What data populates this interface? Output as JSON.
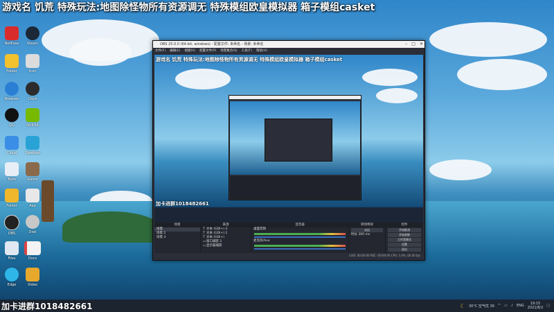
{
  "overlay": {
    "title": "游戏名 饥荒  特殊玩法:地图除怪物所有资源调无 特殊模组欧皇模拟器 箱子模组casket",
    "caption": "加卡进群1018482661"
  },
  "desktop_icons": [
    {
      "label": "NetEase"
    },
    {
      "label": "Steam"
    },
    {
      "label": "Folder"
    },
    {
      "label": "Icon"
    },
    {
      "label": "Browser"
    },
    {
      "label": "Clock"
    },
    {
      "label": "QQ"
    },
    {
      "label": "NVIDIA"
    },
    {
      "label": "Cloud"
    },
    {
      "label": "Desktop"
    },
    {
      "label": "Tools"
    },
    {
      "label": "Game"
    },
    {
      "label": "Folder"
    },
    {
      "label": "App"
    },
    {
      "label": "OBS"
    },
    {
      "label": "Disk"
    },
    {
      "label": "Files"
    },
    {
      "label": "Docs"
    },
    {
      "label": "Edge"
    },
    {
      "label": "Video"
    }
  ],
  "obs": {
    "window_title": "OBS 25.0.0 (64-bit, windows) - 配置文件: 未命名 - 场景: 未命名",
    "menu": [
      "文件(F)",
      "编辑(E)",
      "视图(V)",
      "配置文件(P)",
      "场景集合(S)",
      "工具(T)",
      "帮助(H)"
    ],
    "panels": {
      "scenes": {
        "header": "场景",
        "items": [
          "场景",
          "场景 2",
          "场景 3"
        ]
      },
      "sources": {
        "header": "来源",
        "items": [
          "文本 (GDI+) 3",
          "文本 (GDI+) 2",
          "文本 (GDI+)",
          "窗口捕获 2",
          "显示器捕获"
        ]
      },
      "mixer": {
        "header": "混音器",
        "items": [
          "桌面音频",
          "麦克风/Aux"
        ]
      },
      "transitions": {
        "header": "转场特效",
        "type": "淡出",
        "duration_label": "时长",
        "duration": "300 ms"
      },
      "controls": {
        "header": "控件",
        "buttons": [
          "开始推流",
          "开始录制",
          "工作室模式",
          "设置",
          "退出"
        ]
      }
    },
    "status": "LIVE: 00:00:00   REC: 00:00:00   CPU: 3.4%, 60.00 fps"
  },
  "taskbar": {
    "caption": "加卡进群1018482661",
    "weather": "30°C 空气优 39",
    "lang": "ENG",
    "time": "19:15",
    "date": "2021/8/2"
  }
}
